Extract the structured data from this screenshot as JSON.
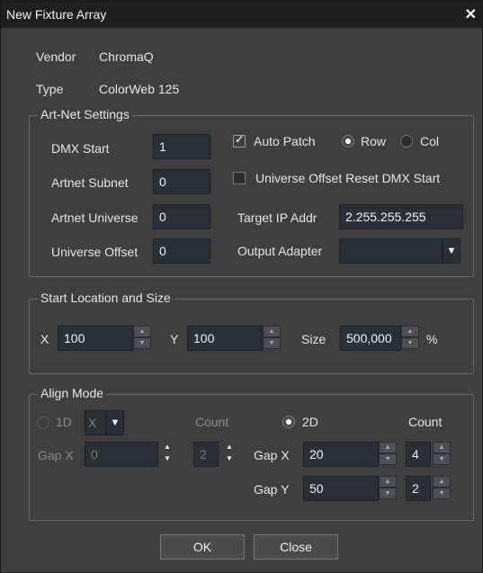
{
  "window": {
    "title": "New Fixture Array"
  },
  "info": {
    "vendor_label": "Vendor",
    "vendor_value": "ChromaQ",
    "type_label": "Type",
    "type_value": "ColorWeb 125"
  },
  "artnet": {
    "title": "Art-Net Settings",
    "dmx_start_label": "DMX Start",
    "dmx_start_value": "1",
    "subnet_label": "Artnet Subnet",
    "subnet_value": "0",
    "universe_label": "Artnet Universe",
    "universe_value": "0",
    "offset_label": "Universe Offset",
    "offset_value": "0",
    "auto_patch_label": "Auto Patch",
    "auto_patch_checked": true,
    "row_label": "Row",
    "col_label": "Col",
    "direction_selected": "Row",
    "offset_reset_label": "Universe Offset Reset DMX Start",
    "offset_reset_checked": false,
    "target_ip_label": "Target IP Addr",
    "target_ip_value": "2.255.255.255",
    "output_adapter_label": "Output Adapter",
    "output_adapter_value": ""
  },
  "location": {
    "title": "Start Location and Size",
    "x_label": "X",
    "x_value": "100",
    "y_label": "Y",
    "y_value": "100",
    "size_label": "Size",
    "size_value": "500,000",
    "size_unit": "%"
  },
  "align": {
    "title": "Align Mode",
    "mode_1d_label": "1D",
    "axis_value": "X",
    "count1_label": "Count",
    "gapx1_label": "Gap X",
    "gapx1_value": "0",
    "count1_value": "2",
    "mode_2d_label": "2D",
    "count2_label": "Count",
    "selected_mode": "2D",
    "gapx2_label": "Gap X",
    "gapx2_value": "20",
    "countx2_value": "4",
    "gapy2_label": "Gap Y",
    "gapy2_value": "50",
    "county2_value": "2"
  },
  "buttons": {
    "ok": "OK",
    "close": "Close"
  },
  "icons": {
    "close": "close-icon",
    "checkmark": "checkmark-icon",
    "dropdown": "chevron-down-icon",
    "spinner": "spinner-arrows-icon"
  }
}
